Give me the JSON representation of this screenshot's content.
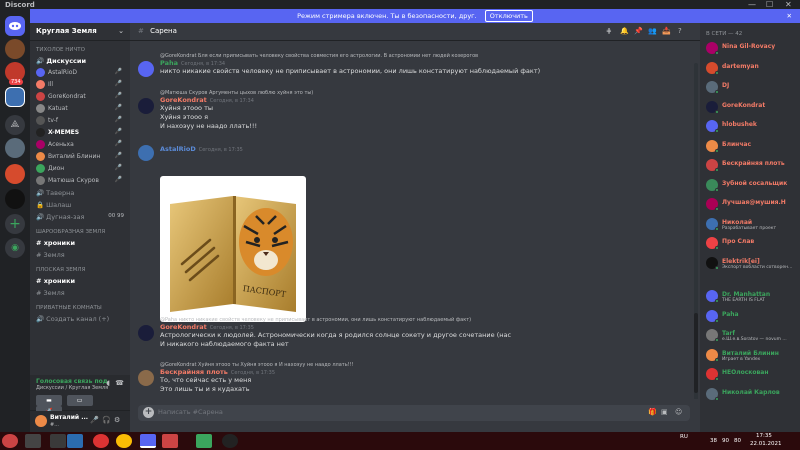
{
  "app": {
    "title": "Discord"
  },
  "window_controls": {
    "min": "—",
    "max": "☐",
    "close": "✕"
  },
  "streamer_banner": {
    "text": "Режим стримера включен. Ты в безопасности, друг.",
    "button": "Отключить",
    "close": "✕"
  },
  "guild_badge": "734",
  "server": {
    "name": "Круглая Земля",
    "chevron": "⌄"
  },
  "channels": {
    "cat1": "тихолое ничто",
    "voice_active": "Дискуссии",
    "voice_users": [
      {
        "name": "AstalRioD"
      },
      {
        "name": "Ill"
      },
      {
        "name": "GoreKondrat"
      },
      {
        "name": "Katuat"
      },
      {
        "name": "tv-f"
      },
      {
        "name": "X-MEMES"
      },
      {
        "name": "Асеньха"
      },
      {
        "name": "Виталий Блинин"
      },
      {
        "name": "Дион"
      },
      {
        "name": "Матюша Скуров"
      }
    ],
    "taverna": "Таверна",
    "shalash": "Шалаш",
    "duryn": "Дугная-зая",
    "duryn_count": "00",
    "duryn_limit": "99",
    "cat2": "шарообразная земля",
    "c2a": "хроники",
    "c2b": "Земля",
    "cat3": "плоская земля",
    "c3a": "хроники",
    "c3b": "Земля",
    "cat4": "приватные комнаты",
    "c4a": "Создать канал (+)"
  },
  "voice_panel": {
    "status": "Голосовая связь под",
    "channel": "Дискуссии / Круглая Земля"
  },
  "user_panel": {
    "name": "Виталий ...",
    "tag": "#..."
  },
  "chat": {
    "channel": "Сарена",
    "input_placeholder": "Написать #Сарена",
    "messages": [
      {
        "reply": "@GoreKondrat Бля если приписывать человеку свойства совместия его астрологии. В астрономии нет людей козерогов",
        "name": "Paha",
        "time": "Сегодня, в 17:34",
        "lines": [
          "никто никакие свойств человеку не приписывает в астрономии, они лишь констатируют наблюдаемый факт)"
        ]
      },
      {
        "reply": "@Матюша Скуров Аргументы цыхов люблю хуйня это ты)",
        "name": "GoreKondrat",
        "time": "Сегодня, в 17:34",
        "lines": [
          "Хуйня этооо ты",
          "Хуйня этооо я",
          "И нахоэуу не наадо ллать!!!"
        ]
      },
      {
        "reply": "",
        "name": "AstalRioD",
        "time": "Сегодня, в 17:35",
        "lines": []
      },
      {
        "reply": "@Paha никто никакие свойств человеку не приписывает в астрономии, они лишь констатируют наблюдаемый факт)",
        "name": "GoreKondrat",
        "time": "Сегодня, в 17:35",
        "lines": [
          "Астрологически к людолей. Астрономически когда я родился солнце сокету и другое сочетание (нас",
          "И никакого наблюдаемого факта нет"
        ]
      },
      {
        "reply": "@GoreKondrat Хуйня этооо ты Хуйня этооо я И нахоэуу не наадо ллать!!!",
        "name": "Бескрайняя плоть",
        "time": "Сегодня, в 17:35",
        "lines": [
          "То, что сейчас есть у меня",
          "Это лишь ты и я кудахать"
        ]
      }
    ],
    "passport_label": "ПАСПОРТ"
  },
  "members": {
    "category": "В СЕТИ — 42",
    "list": [
      {
        "name": "Nina Gil-Rovacy",
        "status": "",
        "color": "#f47b67"
      },
      {
        "name": "dartemyan",
        "status": "",
        "color": "#f47b67"
      },
      {
        "name": "DJ",
        "status": "",
        "color": "#f47b67"
      },
      {
        "name": "GoreKondrat",
        "status": "",
        "color": "#f47b67"
      },
      {
        "name": "hlobushek",
        "status": "",
        "color": "#f47b67"
      },
      {
        "name": "Блинчас",
        "status": "",
        "color": "#f47b67"
      },
      {
        "name": "Бескрайняя плоть",
        "status": "",
        "color": "#f47b67"
      },
      {
        "name": "Зубной сосальщик",
        "status": "",
        "color": "#f47b67"
      },
      {
        "name": "Лучшая@мушия.Н",
        "status": "",
        "color": "#f47b67"
      },
      {
        "name": "Николай",
        "status": "Разрабатывает проект",
        "color": "#f47b67"
      },
      {
        "name": "Про Слав",
        "status": "",
        "color": "#f47b67"
      },
      {
        "name": "Elektrik[ei]",
        "status": "Экспорт вобласти сотворен...",
        "color": "#f47b67"
      },
      {
        "name": "Dr. Manhattan",
        "status": "THE EARTH IS FLAT",
        "color": "#3ba55d"
      },
      {
        "name": "Paha",
        "status": "",
        "color": "#3ba55d"
      },
      {
        "name": "Tarf",
        "status": "е.Ш.е.в.Soratov — novum ...",
        "color": "#3ba55d"
      },
      {
        "name": "Виталий Блинин",
        "status": "Играет в Yandex",
        "color": "#3ba55d"
      },
      {
        "name": "НЕОлоскован",
        "status": "",
        "color": "#3ba55d"
      },
      {
        "name": "Николай Карлов",
        "status": "",
        "color": "#3ba55d"
      }
    ]
  },
  "taskbar": {
    "lang": "RU",
    "time": "17:35",
    "date": "22.01.2021",
    "tray1": "38",
    "tray2": "90",
    "tray3": "80"
  }
}
